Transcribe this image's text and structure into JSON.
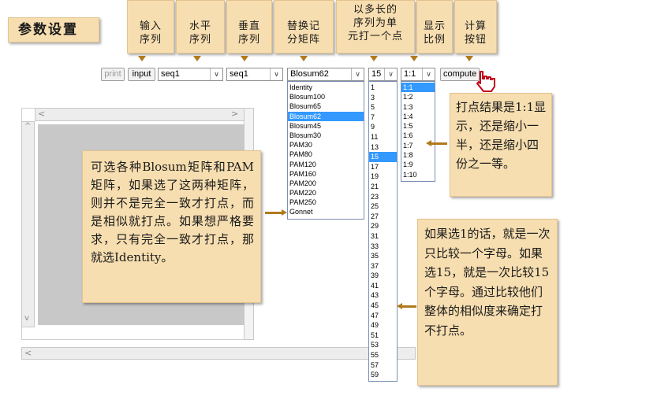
{
  "title": "参数设置",
  "headers": {
    "input": "输入\n序列",
    "horizontal": "水平\n序列",
    "vertical": "垂直\n序列",
    "matrix": "替换记\n分矩阵",
    "window": "以多长的\n序列为单\n元打一个点",
    "scale": "显示\n比例",
    "compute": "计算\n按钮"
  },
  "controls": {
    "print_label": "print",
    "input_label": "input",
    "horizontal_seq": "seq1",
    "vertical_seq": "seq1",
    "matrix_selected": "Blosum62",
    "window_selected": "15",
    "scale_selected": "1:1",
    "compute_label": "compute"
  },
  "matrix_options": [
    "Identity",
    "Blosum100",
    "Blosum65",
    "Blosum62",
    "Blosum45",
    "Blosum30",
    "PAM30",
    "PAM80",
    "PAM120",
    "PAM160",
    "PAM200",
    "PAM220",
    "PAM250",
    "Gonnet"
  ],
  "window_options": [
    "1",
    "3",
    "5",
    "7",
    "9",
    "11",
    "13",
    "15",
    "17",
    "19",
    "21",
    "23",
    "25",
    "27",
    "29",
    "31",
    "33",
    "35",
    "37",
    "39",
    "41",
    "43",
    "45",
    "47",
    "49",
    "51",
    "53",
    "55",
    "57",
    "59"
  ],
  "scale_options": [
    "1:1",
    "1:2",
    "1:3",
    "1:4",
    "1:5",
    "1:6",
    "1:7",
    "1:8",
    "1:9",
    "1:10"
  ],
  "notes": {
    "matrix": "可选各种Blosum矩阵和PAM矩阵，如果选了这两种矩阵，则并不是完全一致才打点，而是相似就打点。如果想严格要求，只有完全一致才打点，那就选Identity。",
    "scale": "打点结果是1:1显示，还是缩小一半，还是缩小四份之一等。",
    "window": "如果选1的话，就是一次只比较一个字母。如果选15，就是一次比较15个字母。通过比较他们整体的相似度来确定打不打点。"
  },
  "colors": {
    "note_bg": "#f7deb0",
    "arrow": "#b07a1c",
    "highlight": "#3399ff"
  }
}
